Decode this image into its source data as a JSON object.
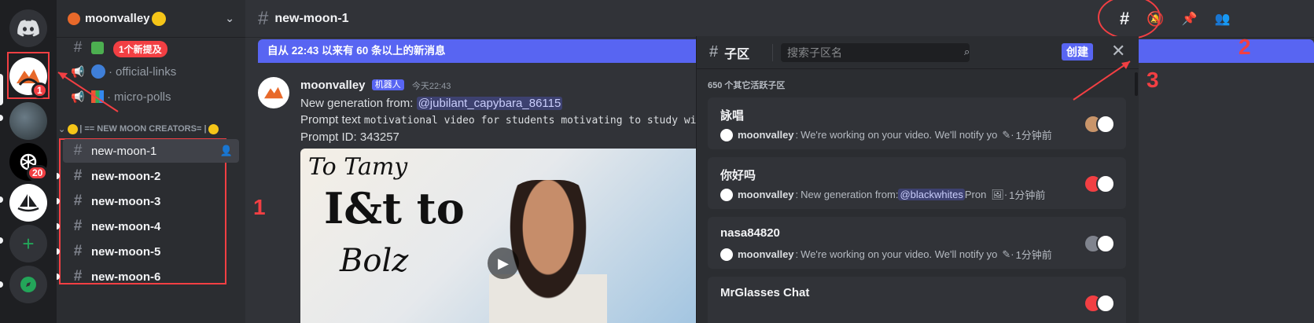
{
  "server": {
    "name": "moonvalley",
    "servers": [
      {
        "name": "discord-home",
        "badge": ""
      },
      {
        "name": "moonvalley",
        "badge": "1"
      },
      {
        "name": "server-2",
        "badge": ""
      },
      {
        "name": "openai",
        "badge": "20"
      },
      {
        "name": "midjourney",
        "badge": ""
      }
    ]
  },
  "sidebar": {
    "mentions_tooltip": "1个新提及",
    "channels_top": [
      {
        "name": "official-links"
      },
      {
        "name": "micro-polls"
      }
    ],
    "category": "| == NEW MOON CREATORS= |",
    "channels": [
      {
        "name": "new-moon-1"
      },
      {
        "name": "new-moon-2"
      },
      {
        "name": "new-moon-3"
      },
      {
        "name": "new-moon-4"
      },
      {
        "name": "new-moon-5"
      },
      {
        "name": "new-moon-6"
      }
    ]
  },
  "header": {
    "channel_title": "new-moon-1"
  },
  "new_messages_bar": "自从 22:43 以来有 60 条以上的新消息",
  "message": {
    "author": "moonvalley",
    "bot_tag": "机器人",
    "time": "今天22:43",
    "line1_prefix": "New generation from: ",
    "mention": "@jubilant_capybara_86115",
    "line2_prefix": "Prompt text ",
    "line2_mono": "motivational video for students motivating to study with b",
    "line3": "Prompt ID: 343257",
    "image_text_1": "To Tamy",
    "image_text_2": "I&t to",
    "image_text_3": "Bolz"
  },
  "threads": {
    "title": "子区",
    "search_placeholder": "搜索子区名",
    "create_label": "创建",
    "count_label": "650 个其它活跃子区",
    "items": [
      {
        "title": "詠唱",
        "author": "moonvalley",
        "text": "We're working on your video. We'll notify yo",
        "mention": "",
        "time": "1分钟前"
      },
      {
        "title": "你好吗",
        "author": "moonvalley",
        "text": "New generation from: ",
        "mention": "@blackwhites",
        "suffix": " Pron",
        "time": "1分钟前"
      },
      {
        "title": "nasa84820",
        "author": "moonvalley",
        "text": "We're working on your video. We'll notify yo",
        "mention": "",
        "time": "1分钟前"
      },
      {
        "title": "MrGlasses Chat",
        "author": "",
        "text": "",
        "mention": "",
        "time": ""
      }
    ]
  },
  "annotations": {
    "one": "1",
    "two": "2",
    "three": "3"
  },
  "colors": {
    "accent": "#5865f2",
    "red": "#f23f43",
    "green": "#23a559"
  }
}
